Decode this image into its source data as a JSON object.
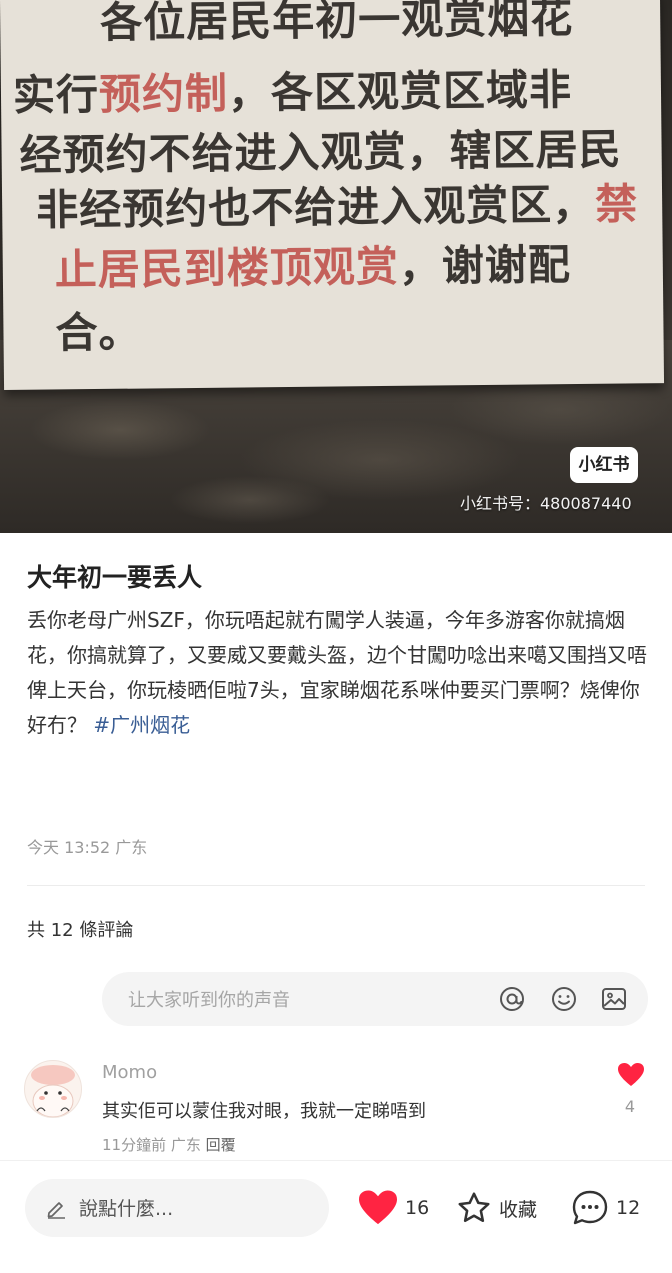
{
  "photo": {
    "notice_lines": [
      {
        "parts": [
          {
            "text": "各位居民年初一观赏烟花",
            "emphasis": false
          }
        ]
      },
      {
        "parts": [
          {
            "text": "实行",
            "emphasis": false
          },
          {
            "text": "预约制",
            "emphasis": true
          },
          {
            "text": "，各区观赏区域非",
            "emphasis": false
          }
        ]
      },
      {
        "parts": [
          {
            "text": "经预约不给进入观赏，辖区居民",
            "emphasis": false
          }
        ]
      },
      {
        "parts": [
          {
            "text": "非经预约也不给进入观赏区，",
            "emphasis": false
          },
          {
            "text": "禁",
            "emphasis": true
          }
        ]
      },
      {
        "parts": [
          {
            "text": "止居民到楼顶观赏",
            "emphasis": true
          },
          {
            "text": "，谢谢配",
            "emphasis": false
          }
        ]
      },
      {
        "parts": [
          {
            "text": "合。",
            "emphasis": false
          }
        ]
      }
    ],
    "watermark_logo": "小红书",
    "watermark_id": "小红书号：480087440"
  },
  "post": {
    "title": "大年初一要丢人",
    "content": "丢你老母广州SZF，你玩唔起就冇闖学人装逼，今年多游客你就搞烟花，你搞就算了，又要威又要戴头盔，边个甘闖叻唸出来噶又围挡又唔俾上天台，你玩棱晒佢啦7头，宜家睇烟花系咪仲要买门票啊？烧俾你好冇？",
    "hashtag": "#广州烟花",
    "time": "今天 13:52",
    "location": "广东"
  },
  "comments_section": {
    "count_label": "共 12 條評論",
    "input_placeholder": "让大家听到你的声音",
    "icons": [
      "at-icon",
      "emoji-icon",
      "image-icon"
    ]
  },
  "comments": [
    {
      "user": "Momo",
      "text": "其实佢可以蒙住我对眼，我就一定睇唔到",
      "time": "11分鐘前",
      "location": "广东",
      "reply_label": "回覆",
      "likes": "4"
    }
  ],
  "bottom_bar": {
    "input_placeholder": "說點什麼...",
    "likes": "16",
    "collect_label": "收藏",
    "comments": "12"
  },
  "colors": {
    "like_red": "#ff2442",
    "hashtag_blue": "#3a5e95",
    "notice_emphasis_red": "#c4605a"
  }
}
